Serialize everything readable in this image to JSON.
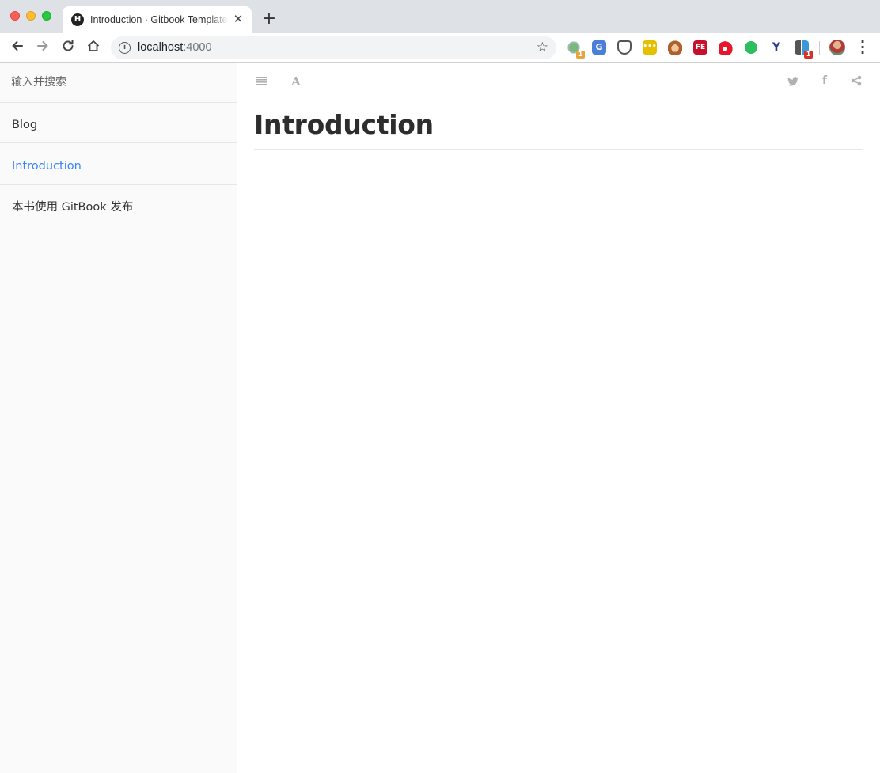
{
  "browser": {
    "tab": {
      "favicon_letter": "H",
      "title": "Introduction · Gitbook Template",
      "close_symbol": "✕"
    },
    "new_tab_symbol": "+",
    "address": {
      "host": "localhost",
      "port": ":4000"
    },
    "extensions": [
      {
        "name": "extension-green-dots-icon",
        "badge": "1",
        "badge_color": "#e8a33a"
      },
      {
        "name": "translate-icon"
      },
      {
        "name": "pocket-icon"
      },
      {
        "name": "yellow-dots-icon"
      },
      {
        "name": "fox-icon"
      },
      {
        "name": "fe-icon"
      },
      {
        "name": "weibo-icon"
      },
      {
        "name": "evernote-icon"
      },
      {
        "name": "y-icon"
      },
      {
        "name": "apps-icon",
        "badge": "1",
        "badge_color": "#d93025"
      }
    ]
  },
  "gitbook": {
    "search": {
      "placeholder": "输入并搜索"
    },
    "summary": [
      {
        "label": "Blog"
      },
      {
        "label": "Introduction",
        "active": true
      },
      {
        "label": "本书使用 GitBook 发布"
      }
    ],
    "header_icons": [
      "summary-toggle-icon",
      "font-settings-icon",
      "twitter-icon",
      "facebook-icon",
      "share-icon"
    ],
    "font_icon_glyph": "A",
    "facebook_glyph": "f",
    "page_title": "Introduction"
  },
  "colors": {
    "active_link": "#3884ff",
    "sidebar_bg": "#fafafa",
    "header_icons": "#b0b0b0"
  }
}
